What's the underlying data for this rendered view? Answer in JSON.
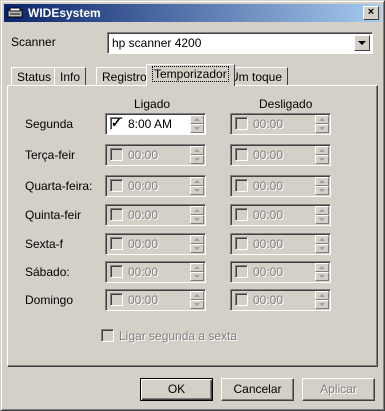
{
  "window": {
    "title": "WIDEsystem",
    "close_glyph": "×"
  },
  "scanner": {
    "label": "Scanner",
    "selected": "hp scanner 4200"
  },
  "tabs": [
    {
      "label": "Status"
    },
    {
      "label": "Info"
    },
    {
      "label": "Registro"
    },
    {
      "label": "Temporizador"
    },
    {
      "label": "Um toque"
    }
  ],
  "headers": {
    "on": "Ligado",
    "off": "Desligado"
  },
  "days": [
    {
      "name": "Segunda",
      "on_time": "8:00 AM",
      "off_time": "00:00",
      "on_checked": true,
      "enabled": true
    },
    {
      "name": "Terça-feir",
      "on_time": "00:00",
      "off_time": "00:00",
      "on_checked": false,
      "enabled": false
    },
    {
      "name": "Quarta-feira:",
      "on_time": "00:00",
      "off_time": "00:00",
      "on_checked": false,
      "enabled": false
    },
    {
      "name": "Quinta-feir",
      "on_time": "00:00",
      "off_time": "00:00",
      "on_checked": false,
      "enabled": false
    },
    {
      "name": "Sexta-f",
      "on_time": "00:00",
      "off_time": "00:00",
      "on_checked": false,
      "enabled": false
    },
    {
      "name": "Sábado:",
      "on_time": "00:00",
      "off_time": "00:00",
      "on_checked": false,
      "enabled": false
    },
    {
      "name": "Domingo",
      "on_time": "00:00",
      "off_time": "00:00",
      "on_checked": false,
      "enabled": false
    }
  ],
  "weekday_option": {
    "label": "Ligar segunda a sexta",
    "checked": false
  },
  "buttons": {
    "ok": "OK",
    "cancel": "Cancelar",
    "apply": "Aplicar"
  },
  "colors": {
    "titlebar_start": "#0a246a",
    "titlebar_end": "#a6caf0",
    "face": "#d4d0c8"
  }
}
